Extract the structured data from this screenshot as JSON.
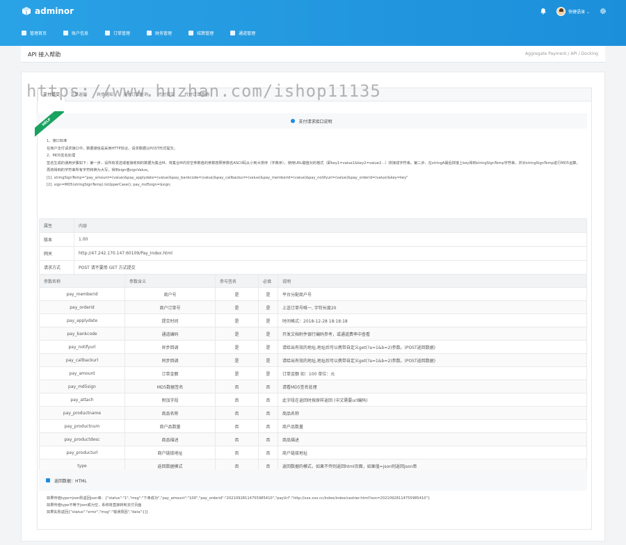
{
  "app": {
    "logo_text": "adminor",
    "username": "快捷语录 ⌄",
    "colors": {
      "primary": "#1d8ce0",
      "help_green": "#1aa260"
    }
  },
  "nav": [
    {
      "label": "管理首页",
      "icon": "home-icon"
    },
    {
      "label": "账户信息",
      "icon": "user-icon"
    },
    {
      "label": "订单管理",
      "icon": "order-icon"
    },
    {
      "label": "财务管理",
      "icon": "finance-icon"
    },
    {
      "label": "结算管理",
      "icon": "settle-icon"
    },
    {
      "label": "通道管理",
      "icon": "channel-icon"
    }
  ],
  "breadcrumb": {
    "title": "API 接入帮助",
    "path": "Aggregate Payment / API / Docking"
  },
  "watermark": "https://www.huzhan.com/ishop11135",
  "tabs": [
    "支付提交",
    "下单返回",
    "异步通知",
    "支付订单查询",
    "代付提交",
    "代付订单查询"
  ],
  "help_ribbon": "HELP",
  "section_title": "支付请求接口说明",
  "description": [
    "1、接口标准",
    "在商户支付请求接口中，数据通信是采用HTTP协议，请求数据以POST形式提交。",
    "2、MD5签名处理",
    "签名生成的通用步骤如下：第一步，设所有发送或者接收到的数据为集合M，将集合M内非空参数值的参数按照参数名ASCII码从小到大排序（字典序），使用URL键值对的格式（即key1=value1&key2=value2…）拼接成字符串。第二步，在stringA最后拼接上key得到stringSignTemp字符串，并对stringSignTemp进行MD5运算，再将得到的字符串所有字符转换为大写，得到sign值signValue。",
    "[1]. stringSignTemp=\"pay_amount=(value)&pay_applydate=(value)&pay_bankcode=(value)&pay_callbackurl=(value)&pay_memberid=(value)&pay_notifyurl=(value)&pay_orderid=(value)&key=key\"",
    "[2]. sign=MD5(stringSignTemp).toUpperCase(); pay_md5sign=$sign;"
  ],
  "info_table": {
    "headers": [
      "属性",
      "内容"
    ],
    "rows": [
      [
        "版本",
        "1.00"
      ],
      [
        "网关",
        "http://47.242.170.147:60109/Pay_Index.html"
      ],
      [
        "请求方式",
        "POST 请不要用 GET 方式提交"
      ]
    ]
  },
  "param_table": {
    "headers": [
      "参数名称",
      "参数含义",
      "参与签名",
      "必填",
      "说明"
    ],
    "rows": [
      [
        "pay_memberid",
        "商户号",
        "是",
        "是",
        "平台分配商户号"
      ],
      [
        "pay_orderid",
        "商户订单号",
        "是",
        "是",
        "上送订单号唯一, 字符长度20"
      ],
      [
        "pay_applydate",
        "提交时间",
        "是",
        "是",
        "时间格式：2018-12-28 18:18:18"
      ],
      [
        "pay_bankcode",
        "通道编码",
        "是",
        "是",
        "开发文档附件银行编码参考，或通道费率中查看"
      ],
      [
        "pay_notifyurl",
        "异步回调",
        "是",
        "是",
        "请给出有效的地址,地址后可以携带自定义get(?a=1&b=2)参数。(POST返回数据)"
      ],
      [
        "pay_callbackurl",
        "同步回调",
        "是",
        "是",
        "请给出有效的地址,地址后可以携带自定义get(?a=1&b=2)参数。(POST返回数据)"
      ],
      [
        "pay_amount",
        "订单金额",
        "是",
        "是",
        "订单金额 如：100 单位：元"
      ],
      [
        "pay_md5sign",
        "MD5数据签名",
        "否",
        "否",
        "请看MD5签名处理"
      ],
      [
        "pay_attach",
        "附加字段",
        "否",
        "否",
        "此字段在返回时按原样返回 (中文需要url编码)"
      ],
      [
        "pay_productname",
        "商品名称",
        "否",
        "否",
        "商品名称"
      ],
      [
        "pay_productnum",
        "商户品数量",
        "否",
        "否",
        "商户品数量"
      ],
      [
        "pay_productdesc",
        "商品描述",
        "否",
        "否",
        "商品描述"
      ],
      [
        "pay_producturl",
        "商户链接地址",
        "否",
        "否",
        "商户链接地址"
      ],
      [
        "type",
        "返回数据模式",
        "否",
        "否",
        "返回数据的模式，如果不传则返回html页面，如果值=json则返回json串"
      ]
    ]
  },
  "return_section": {
    "title": "返回数据：HTML",
    "lines": [
      "如果传值type=json则返回json串：{\"status\":\"1\",\"msg\":\"下单成功\",\"pay_amount\":\"100\",\"pay_orderid\":\"20210928114755985410\",\"payUrl\":\"http://xxx.xxx.cc/index/index/cashier.html?osn=20210928114755985410\"}",
      "如果传值type不等于json或为空，系统将直接转到支付页面",
      "如果失败返回{\"status\":\"error\",\"msg\":\"错误原因\",\"data\":[]}"
    ]
  }
}
